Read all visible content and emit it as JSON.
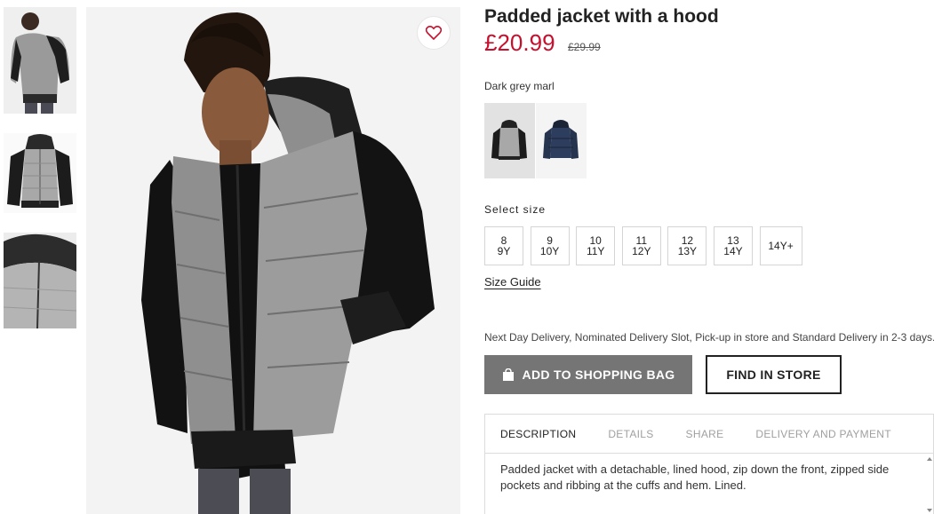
{
  "product": {
    "title": "Padded jacket with a hood",
    "price": "£20.99",
    "old_price": "£29.99",
    "color_name": "Dark grey marl"
  },
  "colors": {
    "accent": "#c8102e",
    "button_bg": "#757575"
  },
  "swatches": [
    {
      "name": "grey-black-jacket",
      "selected": true
    },
    {
      "name": "navy-jacket",
      "selected": false
    }
  ],
  "sizes": {
    "label": "Select size",
    "options": [
      "8\n9Y",
      "9\n10Y",
      "10\n11Y",
      "11\n12Y",
      "12\n13Y",
      "13\n14Y",
      "14Y+"
    ]
  },
  "size_guide": "Size Guide",
  "delivery_text": "Next Day Delivery, Nominated Delivery Slot, Pick-up in store and Standard Delivery in 2-3 days.",
  "buttons": {
    "add_to_bag": "ADD TO SHOPPING BAG",
    "find_in_store": "FIND IN STORE"
  },
  "tabs": [
    "DESCRIPTION",
    "DETAILS",
    "SHARE",
    "DELIVERY AND PAYMENT"
  ],
  "active_tab": "DESCRIPTION",
  "description": "Padded jacket with a detachable, lined hood, zip down the front, zipped side pockets and ribbing at the cuffs and hem. Lined.",
  "icons": {
    "favourite": "heart-icon",
    "bag": "shopping-bag-icon"
  }
}
